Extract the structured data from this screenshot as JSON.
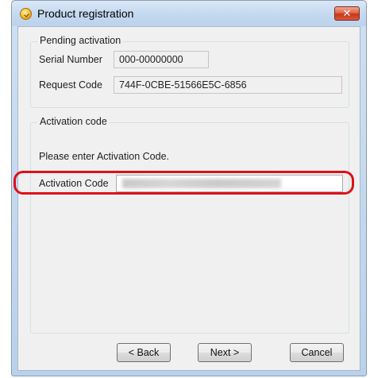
{
  "window": {
    "title": "Product registration",
    "close_label": "✕"
  },
  "pending": {
    "caption": "Pending activation",
    "serial_label": "Serial Number",
    "serial_value": "000-00000000",
    "request_label": "Request Code",
    "request_value": "744F-0CBE-51566E5C-6856"
  },
  "activation": {
    "caption": "Activation code",
    "prompt": "Please enter Activation Code.",
    "code_label": "Activation Code",
    "code_value": ""
  },
  "buttons": {
    "back_label": "< Back",
    "next_label": "Next >",
    "cancel_label": "Cancel"
  },
  "colors": {
    "highlight": "#e0101a",
    "close_button": "#c7361a"
  }
}
